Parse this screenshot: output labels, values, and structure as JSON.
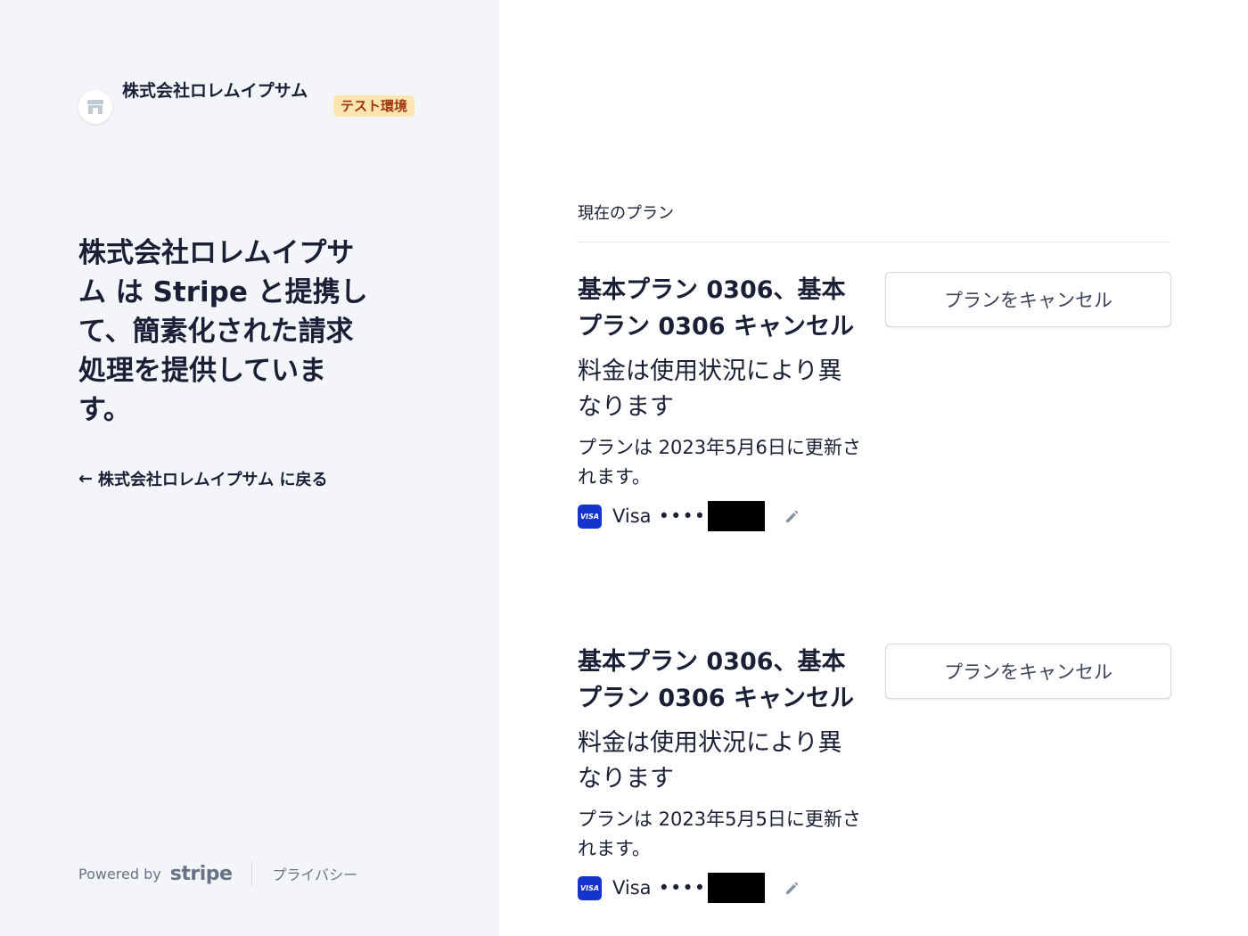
{
  "merchant": {
    "name": "株式会社ロレムイプサム",
    "test_badge": "テスト環境"
  },
  "headline": "株式会社ロレムイプサム は Stripe と提携して、簡素化された請求処理を提供しています。",
  "back_link": "株式会社ロレムイプサム に戻る",
  "footer": {
    "powered_by": "Powered by",
    "stripe": "stripe",
    "privacy": "プライバシー"
  },
  "current_plan": {
    "title": "現在のプラン",
    "plans": [
      {
        "name": "基本プラン 0306、基本プラン 0306 キャンセル",
        "price": "料金は使用状況により異なります",
        "renewal": "プランは 2023年5月6日に更新されます。",
        "card_brand": "Visa",
        "card_dots": "••••",
        "cancel_label": "プランをキャンセル"
      },
      {
        "name": "基本プラン 0306、基本プラン 0306 キャンセル",
        "price": "料金は使用状況により異なります",
        "renewal": "プランは 2023年5月5日に更新されます。",
        "card_brand": "Visa",
        "card_dots": "••••",
        "cancel_label": "プランをキャンセル"
      }
    ]
  },
  "icons": {
    "store": "store-icon",
    "back": "arrow-left-icon",
    "edit": "pencil-icon",
    "visa": "visa-icon"
  },
  "colors": {
    "left_bg": "#f4f5f9",
    "badge_bg": "#fde5b1",
    "badge_text": "#a2360f",
    "visa_blue": "#1434cb"
  }
}
